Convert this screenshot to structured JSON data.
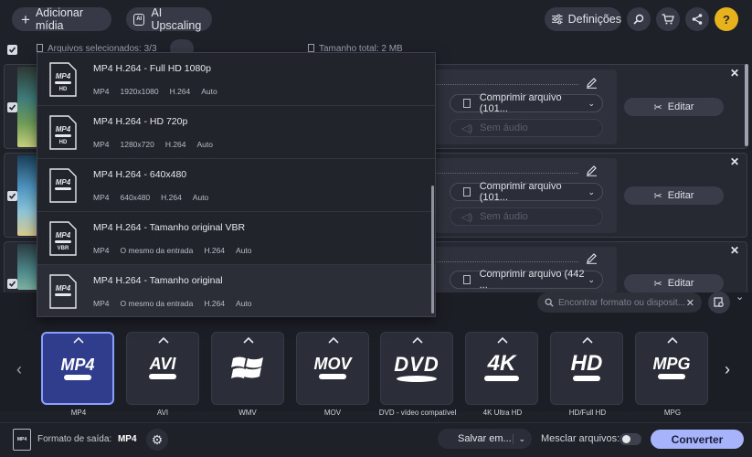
{
  "toolbar": {
    "add_media": "Adicionar mídia",
    "ai_upscaling": "AI Upscaling",
    "settings": "Definições"
  },
  "selection_bar": {
    "selected_files": "Arquivos selecionados: 3/3",
    "total_size": "Tamanho total: 2 MB"
  },
  "files": [
    {
      "compress": "Comprimir arquivo (101...",
      "audio": "Sem áudio",
      "edit": "Editar"
    },
    {
      "compress": "Comprimir arquivo (101...",
      "audio": "Sem áudio",
      "edit": "Editar"
    },
    {
      "compress": "Comprimir arquivo (442 ...",
      "edit": "Editar"
    }
  ],
  "presets": [
    {
      "title": "MP4 H.264 - Full HD 1080p",
      "meta": [
        "MP4",
        "1920x1080",
        "H.264",
        "Auto"
      ],
      "icon_sub": "HD"
    },
    {
      "title": "MP4 H.264 - HD 720p",
      "meta": [
        "MP4",
        "1280x720",
        "H.264",
        "Auto"
      ],
      "icon_sub": "HD"
    },
    {
      "title": "MP4 H.264 - 640x480",
      "meta": [
        "MP4",
        "640x480",
        "H.264",
        "Auto"
      ],
      "icon_sub": ""
    },
    {
      "title": "MP4 H.264 - Tamanho original VBR",
      "meta": [
        "MP4",
        "O mesmo da entrada",
        "H.264",
        "Auto"
      ],
      "icon_sub": "VBR"
    },
    {
      "title": "MP4 H.264 - Tamanho original",
      "meta": [
        "MP4",
        "O mesmo da entrada",
        "H.264",
        "Auto"
      ],
      "icon_sub": ""
    }
  ],
  "format_search": {
    "placeholder": "Encontrar formato ou disposit..."
  },
  "formats": [
    {
      "label": "MP4",
      "logo": "MP4",
      "selected": true
    },
    {
      "label": "AVI",
      "logo": "AVI"
    },
    {
      "label": "WMV",
      "logo": "windows-icon"
    },
    {
      "label": "MOV",
      "logo": "MOV"
    },
    {
      "label": "DVD - vídeo compatível",
      "logo": "DVD"
    },
    {
      "label": "4K Ultra HD",
      "logo": "4K"
    },
    {
      "label": "HD/Full HD",
      "logo": "HD"
    },
    {
      "label": "MPG",
      "logo": "MPG"
    }
  ],
  "bottom": {
    "output_format_label": "Formato de saída:",
    "output_format_value": "MP4",
    "save_to": "Salvar em...",
    "merge_files": "Mesclar arquivos:",
    "convert": "Converter"
  },
  "colors": {
    "accent": "#8aa0ff",
    "convert_bg": "#a7b4fb",
    "bg": "#1f2129"
  }
}
